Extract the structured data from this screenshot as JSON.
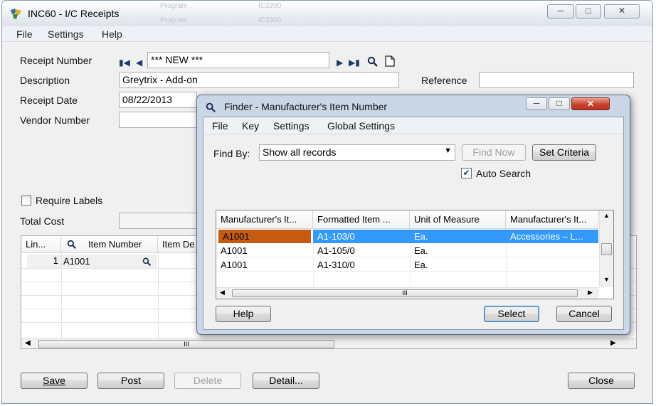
{
  "main": {
    "title": "INC60 - I/C Receipts",
    "faded_bg": [
      "Program",
      "IC2200",
      "Program",
      "IC2300"
    ],
    "menu": [
      "File",
      "Settings",
      "Help"
    ],
    "receipt_number_label": "Receipt Number",
    "receipt_number_value": "*** NEW ***",
    "description_label": "Description",
    "description_value": "Greytrix - Add-on",
    "reference_label": "Reference",
    "reference_value": "",
    "receipt_date_label": "Receipt Date",
    "receipt_date_value": "08/22/2013",
    "vendor_number_label": "Vendor Number",
    "vendor_number_value": "",
    "require_labels_label": "Require Labels",
    "total_cost_label": "Total Cost",
    "grid": {
      "columns": [
        "Lin...",
        "Item Number",
        "Item De"
      ],
      "rows": [
        {
          "line": "1",
          "item": "A1001"
        }
      ]
    },
    "buttons": {
      "save": "Save",
      "post": "Post",
      "delete": "Delete",
      "detail": "Detail...",
      "close": "Close"
    }
  },
  "finder": {
    "title": "Finder - Manufacturer's Item Number",
    "menu": [
      "File",
      "Key",
      "Settings",
      "Global Settings"
    ],
    "find_by_label": "Find By:",
    "find_by_value": "Show all records",
    "find_now": "Find Now",
    "set_criteria": "Set Criteria",
    "auto_search": "Auto Search",
    "auto_search_checked": true,
    "columns": [
      "Manufacturer's It...",
      "Formatted Item ...",
      "Unit of Measure",
      "Manufacturer's It..."
    ],
    "rows": [
      [
        "A1001",
        "A1-103/0",
        "Ea.",
        "Accessories – L..."
      ],
      [
        "A1001",
        "A1-105/0",
        "Ea.",
        ""
      ],
      [
        "A1001",
        "A1-310/0",
        "Ea.",
        ""
      ]
    ],
    "selected_row": 0,
    "help": "Help",
    "select": "Select",
    "cancel": "Cancel",
    "scroll_marker": "III"
  },
  "main_scroll_marker": "III"
}
